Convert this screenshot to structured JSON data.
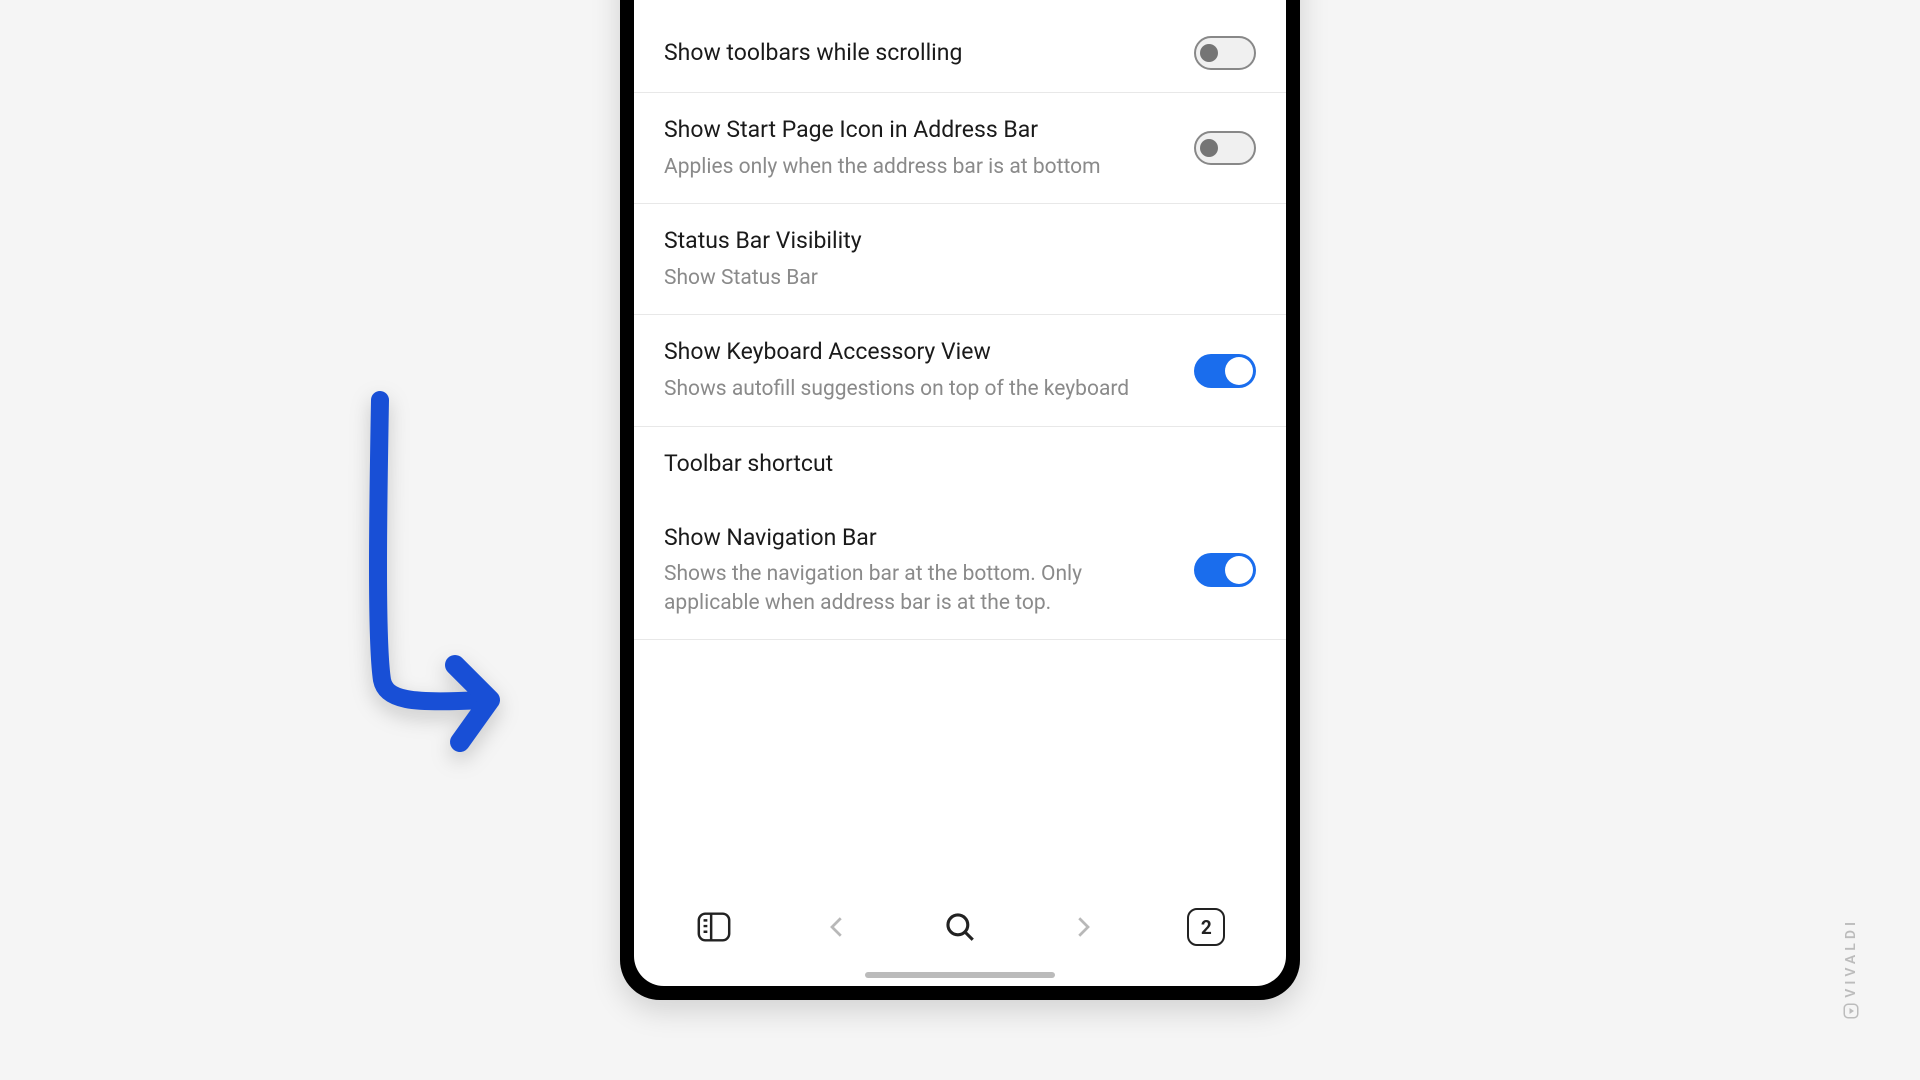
{
  "settings": [
    {
      "title": "Show toolbars while scrolling",
      "subtitle": "",
      "toggle": "off"
    },
    {
      "title": "Show Start Page Icon in Address Bar",
      "subtitle": "Applies only when the address bar is at bottom",
      "toggle": "off"
    },
    {
      "title": "Status Bar Visibility",
      "subtitle": "Show Status Bar",
      "toggle": "none"
    },
    {
      "title": "Show Keyboard Accessory View",
      "subtitle": "Shows autofill suggestions on top of the keyboard",
      "toggle": "on"
    },
    {
      "title": "Toolbar shortcut",
      "subtitle": "",
      "toggle": "none"
    },
    {
      "title": "Show Navigation Bar",
      "subtitle": "Shows the navigation bar at the bottom. Only applicable when address bar is at the top.",
      "toggle": "on"
    }
  ],
  "bottomBar": {
    "tabCount": "2"
  },
  "brand": "VIVALDI"
}
